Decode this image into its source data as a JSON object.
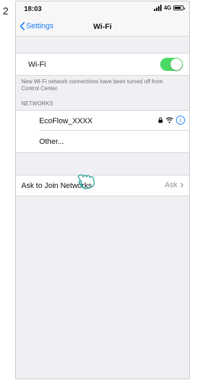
{
  "step_number": "2",
  "status_bar": {
    "time": "18:03",
    "network": "4G"
  },
  "nav": {
    "back_label": "Settings",
    "title": "Wi-Fi"
  },
  "wifi_toggle": {
    "label": "Wi-Fi",
    "on": true
  },
  "notice": "New Wi-Fi network connections have been turned off from Control Center.",
  "networks": {
    "header": "NETWORKS",
    "items": [
      {
        "name": "EcoFlow_XXXX",
        "secured": true
      },
      {
        "name": "Other..."
      }
    ]
  },
  "ask_to_join": {
    "label": "Ask to Join Networks",
    "value": "Ask"
  },
  "colors": {
    "accent": "#1a7cf5",
    "toggle_on": "#4cd964",
    "hand": "#2aa59a"
  }
}
